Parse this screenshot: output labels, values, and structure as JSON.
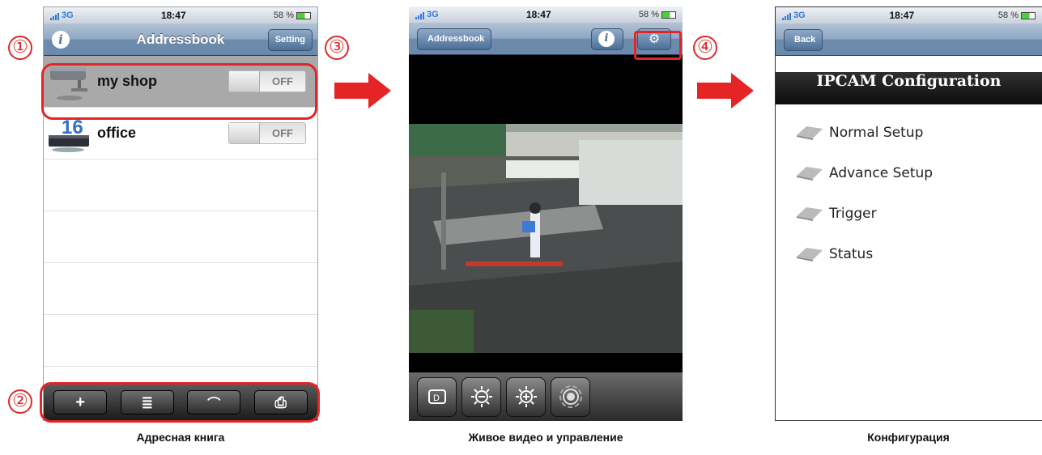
{
  "status": {
    "carrier": "3G",
    "time": "18:47",
    "battery": "58 %"
  },
  "screen1": {
    "title": "Addressbook",
    "setting_label": "Setting",
    "info_glyph": "i",
    "rows": [
      {
        "label": "my shop",
        "toggle": "OFF",
        "icon": "camera-icon"
      },
      {
        "label": "office",
        "toggle": "OFF",
        "icon": "dvr-icon",
        "badge": "16"
      }
    ],
    "toolbar": [
      {
        "glyph": "+",
        "icon": "add-icon"
      },
      {
        "glyph": "≣",
        "icon": "edit-list-icon"
      },
      {
        "glyph": "⌒",
        "icon": "chart-icon"
      },
      {
        "glyph": "⎙",
        "icon": "print-icon"
      }
    ],
    "caption": "Адресная книга"
  },
  "screen2": {
    "back_label": "Addressbook",
    "info_glyph": "i",
    "caption": "Живое видео и управление"
  },
  "screen3": {
    "back_label": "Back",
    "header": "IPCAM Configuration",
    "menu": [
      "Normal Setup",
      "Advance Setup",
      "Trigger",
      "Status"
    ],
    "caption": "Конфигурация"
  },
  "callouts": [
    "①",
    "②",
    "③",
    "④"
  ],
  "colors": {
    "highlight": "#e42425",
    "arrow": "#e42425",
    "navbar": "#6b89ac"
  }
}
